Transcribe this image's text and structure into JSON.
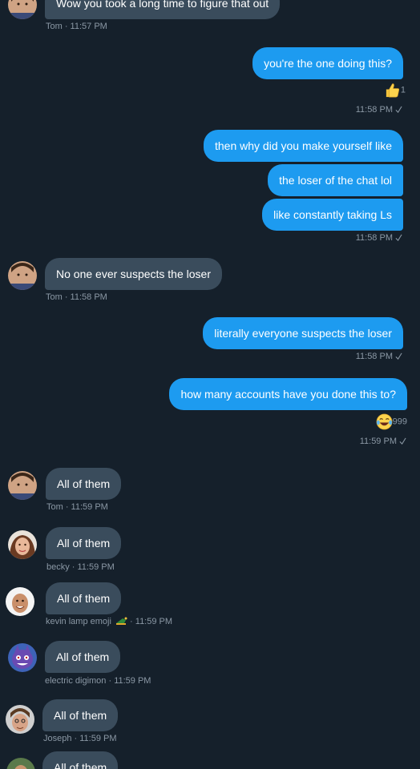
{
  "messages": [
    {
      "text": "Wow you took a long time to figure that out",
      "meta": "Tom · 11:57 PM"
    },
    {
      "text": "you're the one doing this?"
    },
    {
      "reaction_count": "1",
      "meta": "11:58 PM"
    },
    {
      "text": "then why did you make yourself like"
    },
    {
      "text": "the loser of the chat lol"
    },
    {
      "text": "like constantly taking Ls",
      "meta": "11:58 PM"
    },
    {
      "text": "No one ever suspects the loser",
      "meta": "Tom · 11:58 PM"
    },
    {
      "text": "literally everyone suspects the loser",
      "meta": "11:58 PM"
    },
    {
      "text": "how many accounts have you done this to?"
    },
    {
      "reaction_count": "999",
      "meta": "11:59 PM"
    },
    {
      "text": "All of them",
      "meta": "Tom · 11:59 PM"
    },
    {
      "text": "All of them",
      "meta": "becky · 11:59 PM"
    },
    {
      "text": "All of them",
      "meta_name": "kevin lamp emoji",
      "meta_time": "· 11:59 PM"
    },
    {
      "text": "All of them",
      "meta": "electric digimon · 11:59 PM"
    },
    {
      "text": "All of them",
      "meta": "Joseph · 11:59 PM"
    },
    {
      "text": "All of them"
    }
  ],
  "reactions": {
    "thumbs": "thumbs-up-icon",
    "laugh": "tears-of-joy-icon"
  },
  "colors": {
    "background": "#15202b",
    "incoming": "#3a4c5c",
    "outgoing": "#1d9bf0",
    "meta": "#8b98a5"
  }
}
